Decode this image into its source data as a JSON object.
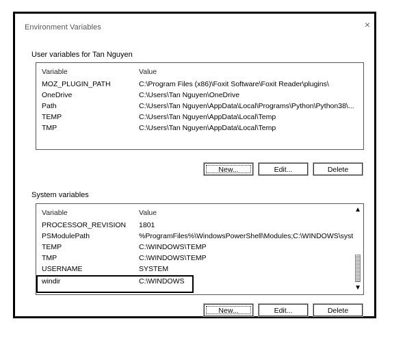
{
  "window": {
    "title": "Environment Variables"
  },
  "user_section": {
    "label": "User variables for Tan Nguyen",
    "header": {
      "variable": "Variable",
      "value": "Value"
    },
    "rows": [
      {
        "variable": "MOZ_PLUGIN_PATH",
        "value": "C:\\Program Files (x86)\\Foxit Software\\Foxit Reader\\plugins\\"
      },
      {
        "variable": "OneDrive",
        "value": "C:\\Users\\Tan Nguyen\\OneDrive"
      },
      {
        "variable": "Path",
        "value": "C:\\Users\\Tan Nguyen\\AppData\\Local\\Programs\\Python\\Python38\\..."
      },
      {
        "variable": "TEMP",
        "value": "C:\\Users\\Tan Nguyen\\AppData\\Local\\Temp"
      },
      {
        "variable": "TMP",
        "value": "C:\\Users\\Tan Nguyen\\AppData\\Local\\Temp"
      }
    ],
    "buttons": {
      "new": "New...",
      "edit": "Edit...",
      "delete": "Delete"
    }
  },
  "system_section": {
    "label": "System variables",
    "header": {
      "variable": "Variable",
      "value": "Value"
    },
    "rows": [
      {
        "variable": "PROCESSOR_REVISION",
        "value": "1801"
      },
      {
        "variable": "PSModulePath",
        "value": "%ProgramFiles%\\WindowsPowerShell\\Modules;C:\\WINDOWS\\syst..."
      },
      {
        "variable": "TEMP",
        "value": "C:\\WINDOWS\\TEMP"
      },
      {
        "variable": "TMP",
        "value": "C:\\WINDOWS\\TEMP"
      },
      {
        "variable": "USERNAME",
        "value": "SYSTEM"
      },
      {
        "variable": "windir",
        "value": "C:\\WINDOWS"
      }
    ],
    "buttons": {
      "new": "New...",
      "edit": "Edit...",
      "delete": "Delete"
    }
  },
  "icons": {
    "close": "×",
    "scroll_up": "▲",
    "scroll_down": "▼"
  }
}
